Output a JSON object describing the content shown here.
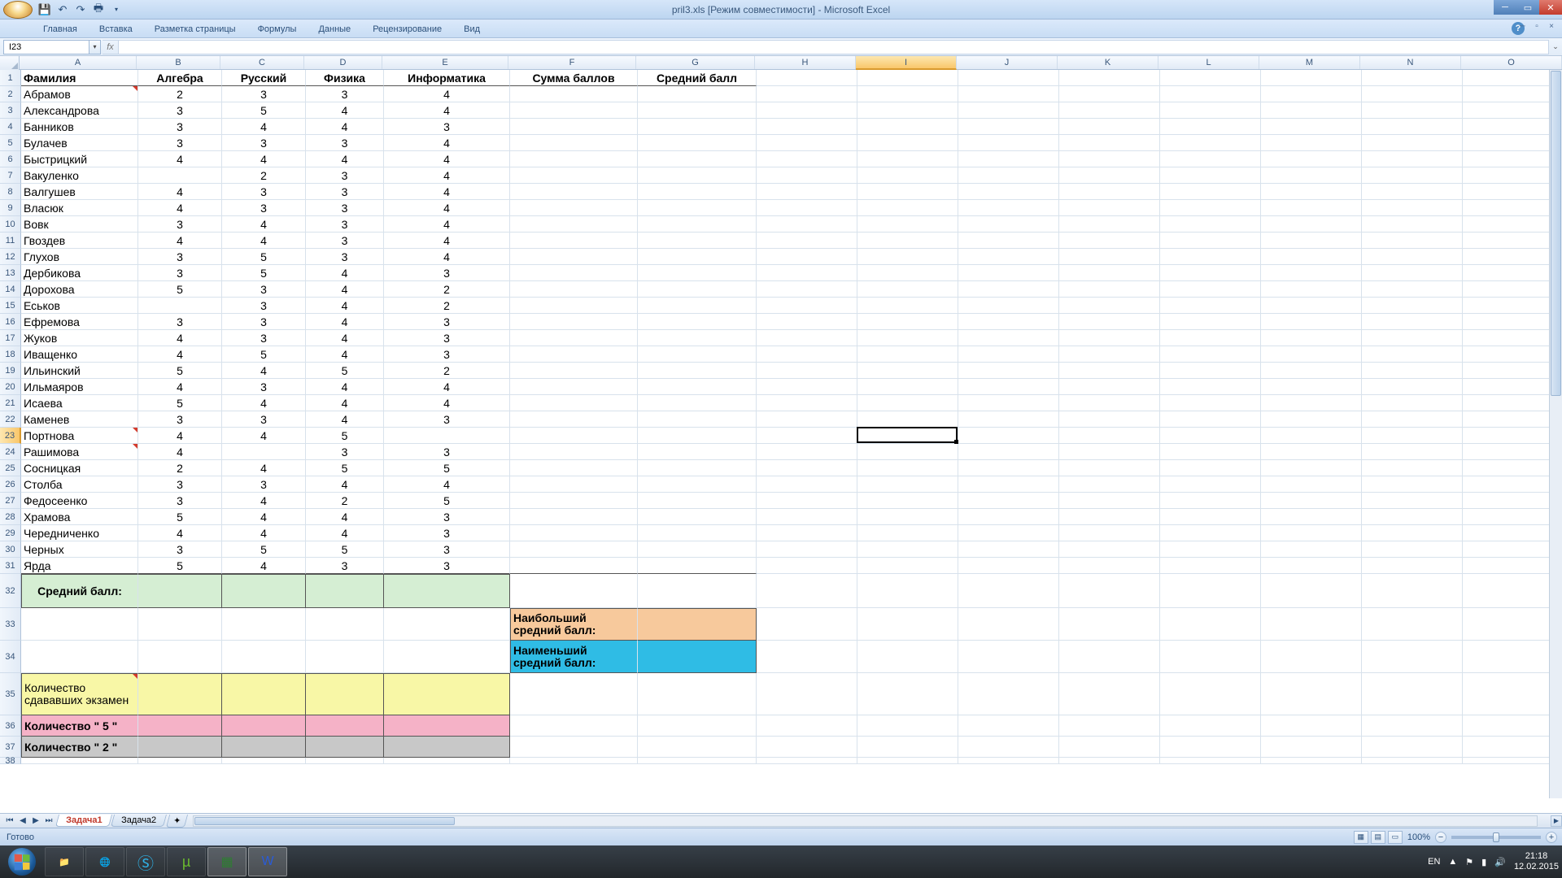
{
  "title": "pril3.xls  [Режим совместимости] - Microsoft Excel",
  "ribbon_tabs": [
    "Главная",
    "Вставка",
    "Разметка страницы",
    "Формулы",
    "Данные",
    "Рецензирование",
    "Вид"
  ],
  "namebox": "I23",
  "formula": "",
  "fx_label": "fx",
  "columns": [
    "A",
    "B",
    "C",
    "D",
    "E",
    "F",
    "G",
    "H",
    "I",
    "J",
    "K",
    "L",
    "M",
    "N",
    "O"
  ],
  "headers": {
    "A": "Фамилия",
    "B": "Алгебра",
    "C": "Русский",
    "D": "Физика",
    "E": "Информатика",
    "F": "Сумма баллов",
    "G": "Средний балл"
  },
  "rows": [
    [
      "Абрамов",
      "2",
      "3",
      "3",
      "4"
    ],
    [
      "Александрова",
      "3",
      "5",
      "4",
      "4"
    ],
    [
      "Банников",
      "3",
      "4",
      "4",
      "3"
    ],
    [
      "Булачев",
      "3",
      "3",
      "3",
      "4"
    ],
    [
      "Быстрицкий",
      "4",
      "4",
      "4",
      "4"
    ],
    [
      "Вакуленко",
      "",
      "2",
      "3",
      "4"
    ],
    [
      "Валгушев",
      "4",
      "3",
      "3",
      "4"
    ],
    [
      "Власюк",
      "4",
      "3",
      "3",
      "4"
    ],
    [
      "Вовк",
      "3",
      "4",
      "3",
      "4"
    ],
    [
      "Гвоздев",
      "4",
      "4",
      "3",
      "4"
    ],
    [
      "Глухов",
      "3",
      "5",
      "3",
      "4"
    ],
    [
      "Дербикова",
      "3",
      "5",
      "4",
      "3"
    ],
    [
      "Дорохова",
      "5",
      "3",
      "4",
      "2"
    ],
    [
      "Еськов",
      "",
      "3",
      "4",
      "2"
    ],
    [
      "Ефремова",
      "3",
      "3",
      "4",
      "3"
    ],
    [
      "Жуков",
      "4",
      "3",
      "4",
      "3"
    ],
    [
      "Иващенко",
      "4",
      "5",
      "4",
      "3"
    ],
    [
      "Ильинский",
      "5",
      "4",
      "5",
      "2"
    ],
    [
      "Ильмаяров",
      "4",
      "3",
      "4",
      "4"
    ],
    [
      "Исаева",
      "5",
      "4",
      "4",
      "4"
    ],
    [
      "Каменев",
      "3",
      "3",
      "4",
      "3"
    ],
    [
      "Портнова",
      "4",
      "4",
      "5",
      ""
    ],
    [
      "Рашимова",
      "4",
      "",
      "3",
      "3"
    ],
    [
      "Сосницкая",
      "2",
      "4",
      "5",
      "5"
    ],
    [
      "Столба",
      "3",
      "3",
      "4",
      "4"
    ],
    [
      "Федосеенко",
      "3",
      "4",
      "2",
      "5"
    ],
    [
      "Храмова",
      "5",
      "4",
      "4",
      "3"
    ],
    [
      "Чередниченко",
      "4",
      "4",
      "4",
      "3"
    ],
    [
      "Черных",
      "3",
      "5",
      "5",
      "3"
    ],
    [
      "Ярда",
      "5",
      "4",
      "3",
      "3"
    ]
  ],
  "label_avg": "Средний балл:",
  "label_max": "Наибольший средний балл:",
  "label_min": "Наименьший средний балл:",
  "label_count": "Количество сдававших экзамен",
  "label_c5": "Количество \" 5 \"",
  "label_c2": "Количество \" 2 \"",
  "sheets": [
    "Задача1",
    "Задача2"
  ],
  "status_ready": "Готово",
  "zoom": "100%",
  "tray": {
    "lang": "EN",
    "time": "21:18",
    "date": "12.02.2015"
  }
}
